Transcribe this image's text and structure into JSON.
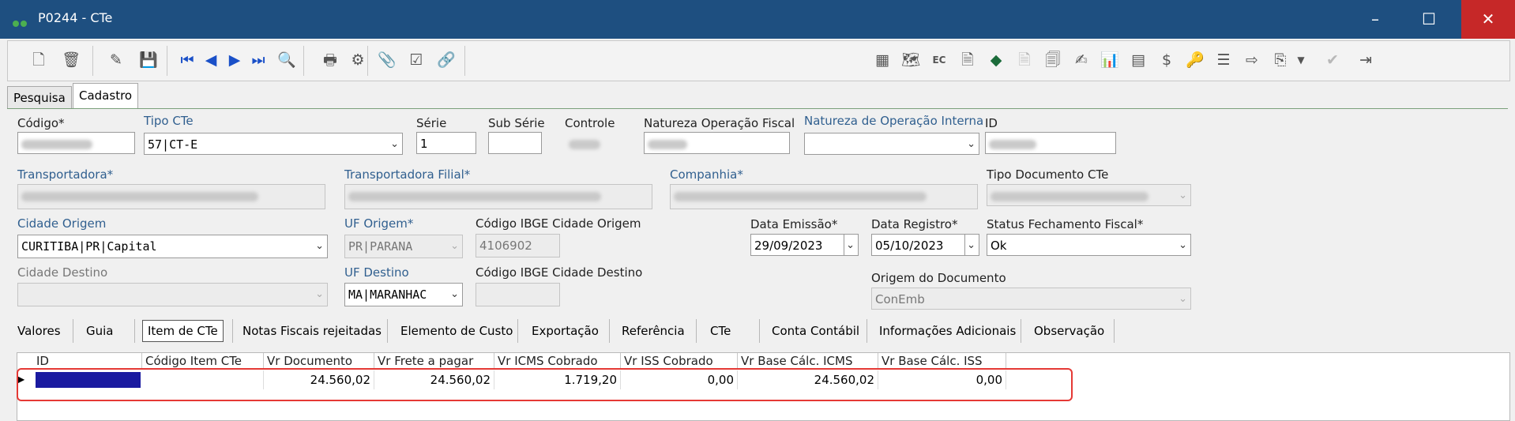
{
  "window": {
    "title": "P0244 - CTe",
    "minimize": "–",
    "maximize": "☐",
    "close": "✕"
  },
  "toolbar": {
    "left_icons": [
      "new-document-icon",
      "delete-icon",
      "edit-icon",
      "save-icon",
      "first-record-icon",
      "previous-record-icon",
      "next-record-icon",
      "last-record-icon",
      "search-record-icon",
      "print-icon",
      "settings-icon",
      "attachment-icon",
      "check-icon",
      "link-icon"
    ],
    "right_icons": [
      "calculator-icon",
      "map-icon",
      "ec-icon",
      "document-search-icon",
      "diamond-icon",
      "disabled-document-icon",
      "pages-icon",
      "edit-form-icon",
      "chart-document-icon",
      "table-icon",
      "money-icon",
      "key-icon",
      "list-icon",
      "export-icon",
      "copy-icon",
      "dropdown-icon",
      "approve-icon",
      "exit-icon"
    ],
    "ec_label": "EC"
  },
  "form_tabs": [
    "Pesquisa",
    "Cadastro"
  ],
  "labels": {
    "codigo": "Código*",
    "tipo_cte": "Tipo CTe",
    "serie": "Série",
    "sub_serie": "Sub Série",
    "controle": "Controle",
    "natureza_fiscal": "Natureza Operação Fiscal",
    "natureza_interna": "Natureza de Operação Interna",
    "id": "ID",
    "transportadora": "Transportadora*",
    "transportadora_filial": "Transportadora Filial*",
    "companhia": "Companhia*",
    "tipo_documento": "Tipo Documento CTe",
    "cidade_origem": "Cidade Origem",
    "uf_origem": "UF Origem*",
    "ibge_origem": "Código IBGE Cidade Origem",
    "data_emissao": "Data Emissão*",
    "data_registro": "Data Registro*",
    "status_fechamento": "Status Fechamento Fiscal*",
    "cidade_destino": "Cidade Destino",
    "uf_destino": "UF Destino",
    "ibge_destino": "Código IBGE Cidade Destino",
    "origem_documento": "Origem do Documento"
  },
  "values": {
    "tipo_cte": "57|CT-E",
    "serie": "1",
    "cidade_origem": "CURITIBA|PR|Capital",
    "uf_origem": "PR|PARANA",
    "ibge_origem": "4106902",
    "data_emissao": "29/09/2023",
    "data_registro": "05/10/2023",
    "status_fechamento": "Ok",
    "uf_destino": "MA|MARANHAC",
    "origem_documento": "ConEmb"
  },
  "sub_tabs": [
    "Valores",
    "Guia",
    "Item de CTe",
    "Notas Fiscais rejeitadas",
    "Elemento de Custo",
    "Exportação",
    "Referência",
    "CTe",
    "Conta Contábil",
    "Informações Adicionais",
    "Observação"
  ],
  "grid": {
    "columns": [
      "ID",
      "Código Item CTe",
      "Vr Documento",
      "Vr Frete a pagar",
      "Vr ICMS Cobrado",
      "Vr ISS Cobrado",
      "Vr Base Cálc. ICMS",
      "Vr Base Cálc. ISS"
    ],
    "rows": [
      {
        "id": "",
        "codigo_item": "",
        "vr_documento": "24.560,02",
        "vr_frete": "24.560,02",
        "vr_icms": "1.719,20",
        "vr_iss": "0,00",
        "base_icms": "24.560,02",
        "base_iss": "0,00"
      }
    ]
  },
  "colors": {
    "titlebar": "#1e4f80",
    "close": "#c62828",
    "highlight": "#e53935",
    "selection": "#1a1aa0"
  }
}
